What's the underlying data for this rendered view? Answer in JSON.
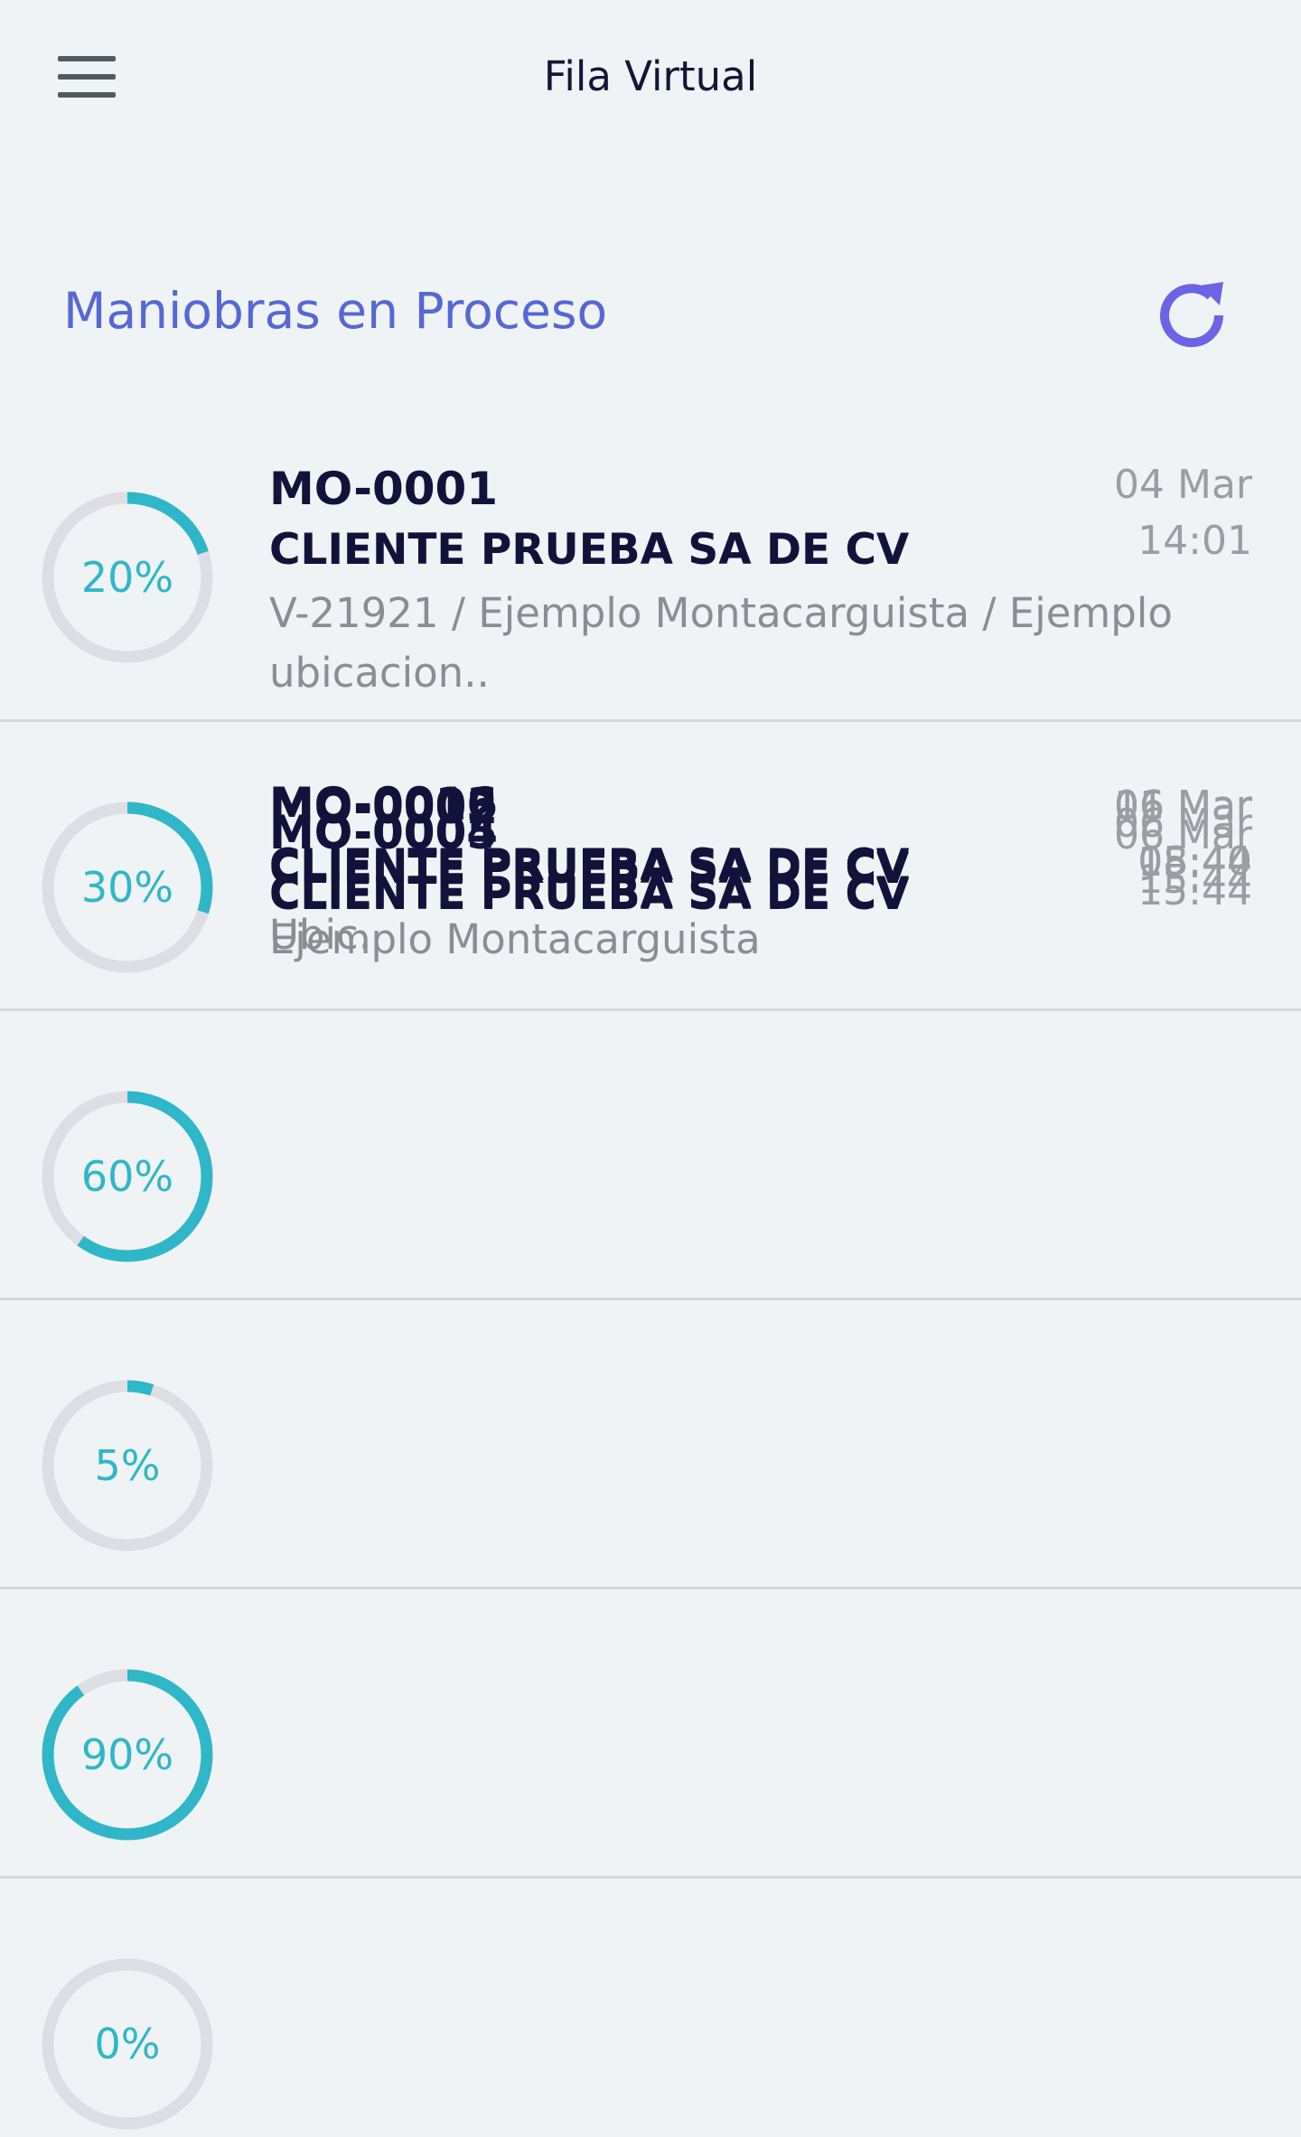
{
  "header": {
    "title": "Fila Virtual",
    "menu_icon": "hamburger-menu-icon"
  },
  "section": {
    "title": "Maniobras en Proceso",
    "refresh_icon": "refresh-icon",
    "refresh_color": "#6c63e6"
  },
  "colors": {
    "progress": "#2fb7c9",
    "track": "#dcdee3",
    "heading": "#5568d6"
  },
  "maniobras": [
    {
      "pct_label": "20%",
      "progress": 0.2,
      "code": "MO-0001",
      "client": "CLIENTE PRUEBA SA DE CV",
      "detail": "V-21921 / Ejemplo Montacarguista / Ejemplo ubicacion..",
      "date": "04 Mar",
      "time": "14:01"
    },
    {
      "pct_label": "30%",
      "progress": 0.3,
      "code": "MO-0002",
      "client": "CLIENTE PRUEBA SA DE CV",
      "detail": "Ejemplo Montacarguista",
      "date": "06 Mar",
      "time": "15:44"
    },
    {
      "pct_label": "60%",
      "progress": 0.6,
      "code": "MO-0003",
      "client": "CLIENTE PRUEBA SA DE CV",
      "detail": "Ubic.",
      "date": "06 Mar",
      "time": "15:44"
    },
    {
      "pct_label": "5%",
      "progress": 0.05,
      "code": "MO-0004",
      "client": "CLIENTE PRUEBA SA DE CV",
      "detail": "",
      "date": "06 Mar",
      "time": "15:44"
    },
    {
      "pct_label": "90%",
      "progress": 0.9,
      "code": "MO-0005",
      "client": "CLIENTE PRUEBA SA DE CV",
      "detail": "",
      "date": "06 Mar",
      "time": "15:44"
    },
    {
      "pct_label": "0%",
      "progress": 0.0,
      "code": "MO-0016",
      "client": "CLIENTE PRUEBA SA DE CV",
      "detail": "",
      "date": "11 Mar",
      "time": "08:40"
    }
  ]
}
